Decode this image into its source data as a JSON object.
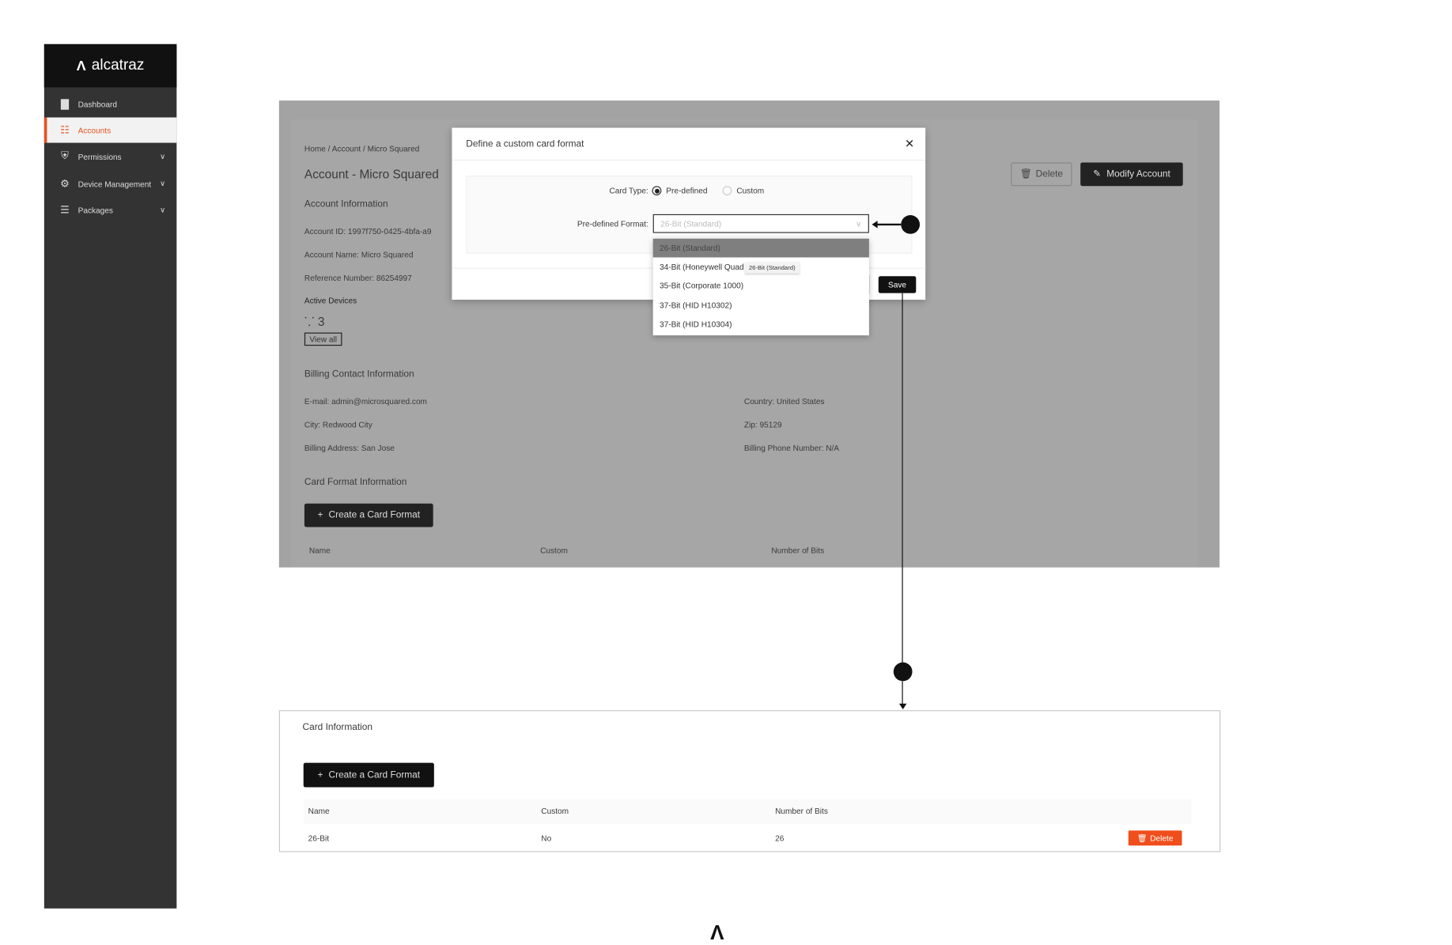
{
  "sidebar": {
    "brand": "alcatraz",
    "items": [
      {
        "label": "Dashboard",
        "icon": "bar-chart-icon",
        "active": false
      },
      {
        "label": "Accounts",
        "icon": "account-icon",
        "active": true
      },
      {
        "label": "Permissions",
        "icon": "shield-check-icon",
        "active": false,
        "expandable": true
      },
      {
        "label": "Device Management",
        "icon": "gear-icon",
        "active": false,
        "expandable": true
      },
      {
        "label": "Packages",
        "icon": "package-list-icon",
        "active": false,
        "expandable": true
      }
    ],
    "accent": "#e8531f"
  },
  "account": {
    "breadcrumb": [
      "Home",
      "Account",
      "Micro Squared"
    ],
    "title": "Account - Micro Squared",
    "delete_label": "Delete",
    "modify_label": "Modify Account",
    "info_heading": "Account Information",
    "account_id_label": "Account ID:",
    "account_id": "1997f750-0425-4bfa-a9",
    "account_name_label": "Account Name:",
    "account_name": "Micro Squared",
    "reference_label": "Reference Number:",
    "reference": "86254997",
    "active_devices_label": "Active Devices",
    "active_devices": "3",
    "view_all": "View all",
    "billing_heading": "Billing Contact Information",
    "email_label": "E-mail:",
    "email": "admin@microsquared.com",
    "city_label": "City:",
    "city": "Redwood City",
    "address_label": "Billing Address:",
    "address": "San Jose",
    "country_label": "Country:",
    "country": "United States",
    "zip_label": "Zip:",
    "zip": "95129",
    "phone_label": "Billing Phone Number:",
    "phone": "N/A",
    "card_heading": "Card Format Information",
    "create_label": "Create a Card Format",
    "columns": [
      "Name",
      "Custom",
      "Number of Bits"
    ]
  },
  "modal": {
    "title": "Define a custom card format",
    "card_type_label": "Card Type:",
    "options": [
      "Pre-defined",
      "Custom"
    ],
    "selected_option": "Pre-defined",
    "format_label": "Pre-defined Format:",
    "format_value": "26-Bit (Standard)",
    "dropdown": [
      "26-Bit (Standard)",
      "34-Bit (Honeywell Quad",
      "35-Bit (Corporate 1000)",
      "37-Bit (HID H10302)",
      "37-Bit (HID H10304)"
    ],
    "tooltip": "26-Bit (Standard)",
    "save_label": "Save"
  },
  "card_info": {
    "heading": "Card Information",
    "create_label": "Create a Card Format",
    "columns": [
      "Name",
      "Custom",
      "Number of Bits"
    ],
    "rows": [
      {
        "name": "26-Bit",
        "custom": "No",
        "bits": "26",
        "action": "Delete"
      }
    ],
    "delete_color": "#f04e1c"
  }
}
